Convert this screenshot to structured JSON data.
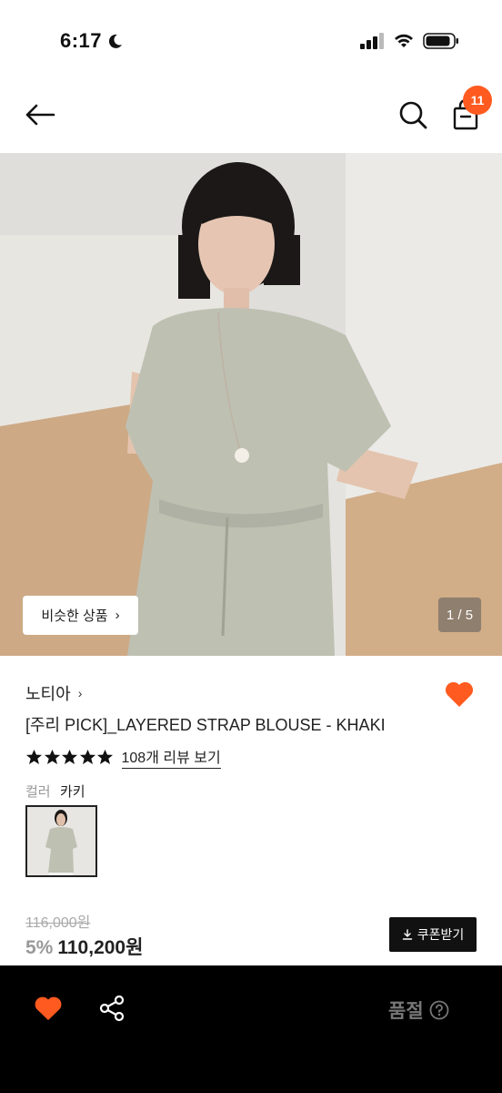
{
  "status_bar": {
    "time": "6:17"
  },
  "header": {
    "cart_count": "11"
  },
  "gallery": {
    "similar_label": "비슷한 상품",
    "counter": "1 / 5"
  },
  "product": {
    "brand": "노티아",
    "title": "[주리 PICK]_LAYERED STRAP BLOUSE - KHAKI",
    "rating_stars": 5,
    "review_link": "108개 리뷰 보기",
    "color_label": "컬러",
    "color_value": "카키",
    "original_price": "116,000원",
    "discount": "5%",
    "sale_price": "110,200원",
    "coupon_label": "쿠폰받기"
  },
  "bottom_bar": {
    "soldout_label": "품절"
  },
  "colors": {
    "accent": "#ff5a1f",
    "dark": "#111111"
  }
}
